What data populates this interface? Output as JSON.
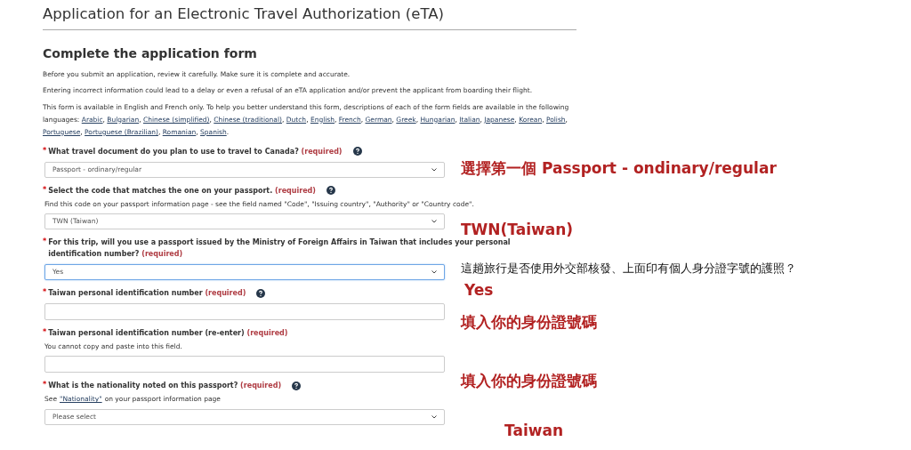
{
  "page_title": "Application for an Electronic Travel Authorization (eTA)",
  "section_heading": "Complete the application form",
  "intro": [
    "Before you submit an application, review it carefully. Make sure it is complete and accurate.",
    "Entering incorrect information could lead to a delay or even a refusal of an eTA application and/or prevent the applicant from boarding their flight."
  ],
  "languages_text": "This form is available in English and French only. To help you better understand this form, descriptions of each of the form fields are available in the following languages:",
  "languages_separator": ",",
  "languages_end": ".",
  "languages": [
    "Arabic",
    "Bulgarian",
    "Chinese (simplified)",
    "Chinese (traditional)",
    "Dutch",
    "English",
    "French",
    "German",
    "Greek",
    "Hungarian",
    "Italian",
    "Japanese",
    "Korean",
    "Polish",
    "Portuguese",
    "Portuguese (Brazilian)",
    "Romanian",
    "Spanish"
  ],
  "fields": [
    {
      "kind": "select",
      "marker": "*",
      "label": "What travel document do you plan to use to travel to Canada?",
      "required": "(required)",
      "help": true,
      "value": "Passport - ordinary/regular",
      "focused": false
    },
    {
      "kind": "select",
      "marker": "*",
      "label": "Select the code that matches the one on your passport.",
      "required": "(required)",
      "help": true,
      "hint": "Find this code on your passport information page - see the field named \"Code\", \"Issuing country\", \"Authority\" or \"Country code\".",
      "value": "TWN (Taiwan)",
      "focused": false
    },
    {
      "kind": "select",
      "marker": "*",
      "label": "For this trip, will you use a passport issued by the Ministry of Foreign Affairs in Taiwan that includes your personal identification number?",
      "required": "(required)",
      "help": false,
      "value": "Yes",
      "focused": true
    },
    {
      "kind": "text",
      "marker": "*",
      "label": "Taiwan personal identification number",
      "required": "(required)",
      "help": true,
      "focused": false
    },
    {
      "kind": "text",
      "marker": "*",
      "label": "Taiwan personal identification number (re-enter)",
      "required": "(required)",
      "help": false,
      "hint": "You cannot copy and paste into this field.",
      "focused": false
    },
    {
      "kind": "select",
      "marker": "*",
      "label": "What is the nationality noted on this passport?",
      "required": "(required)",
      "help": true,
      "hint_prefix": "See",
      "hint_link": "\"Nationality\"",
      "hint_suffix": "on your passport information page",
      "value": "Please select",
      "focused": false
    }
  ],
  "annotations": [
    {
      "kind": "highlight",
      "text": "選擇第一個 Passport - ondinary/regular"
    },
    {
      "kind": "highlight",
      "text": "TWN(Taiwan)"
    },
    {
      "kind": "note",
      "text": "這趟旅行是否使用外交部核發、上面印有個人身分證字號的護照？"
    },
    {
      "kind": "highlight",
      "text": "Yes"
    },
    {
      "kind": "highlight",
      "text": "填入你的身份證號碼"
    },
    {
      "kind": "highlight",
      "text": "填入你的身份證號碼"
    },
    {
      "kind": "highlight",
      "text": "Taiwan"
    }
  ]
}
